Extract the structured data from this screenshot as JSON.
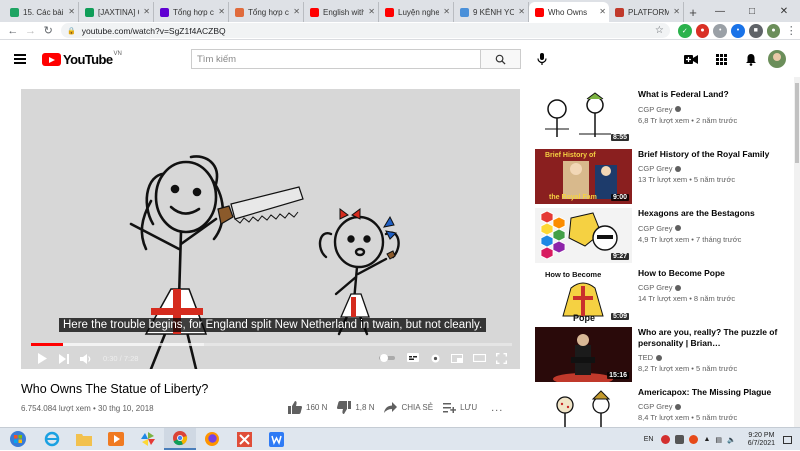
{
  "browser": {
    "tabs": [
      {
        "title": "15. Các bài S",
        "icon": "google-drive-icon",
        "color": "#1fa463"
      },
      {
        "title": "[JAXTINA] C",
        "icon": "google-sheets-icon",
        "color": "#0f9d58"
      },
      {
        "title": "Tổng hợp c",
        "icon": "yahoo-icon",
        "color": "#6001d2"
      },
      {
        "title": "Tổng hợp cá",
        "icon": "pinwheel-icon",
        "color": "#e06b3c"
      },
      {
        "title": "English with",
        "icon": "youtube-icon",
        "color": "#ff0000"
      },
      {
        "title": "Luyện nghe",
        "icon": "youtube-icon",
        "color": "#ff0000"
      },
      {
        "title": "9 KÊNH YO",
        "icon": "globe-icon",
        "color": "#4a90d9"
      },
      {
        "title": "Who Owns",
        "icon": "youtube-icon",
        "color": "#ff0000"
      },
      {
        "title": "PLATFORM",
        "icon": "platform-icon",
        "color": "#c0392b"
      }
    ],
    "url": "youtube.com/watch?v=SgZ1f4ACZBQ"
  },
  "yt": {
    "logo_text": "YouTube",
    "country_code": "VN",
    "search_placeholder": "Tìm kiếm"
  },
  "player": {
    "subtitle": "Here the trouble begins, for England split New Netherland in twain, but not cleanly.",
    "time": "0:30 / 7:28",
    "progress_fraction": 0.067,
    "loaded_fraction": 0.36
  },
  "video": {
    "title": "Who Owns The Statue of Liberty?",
    "meta": "6.754.084 lượt xem • 30 thg 10, 2018",
    "likes": "160 N",
    "dislikes": "1,8 N",
    "share": "CHIA SẺ",
    "save": "LƯU",
    "more": "..."
  },
  "sidebar": {
    "items": [
      {
        "title": "What is Federal Land?",
        "channel": "CGP Grey",
        "stats": "6,8 Tr lượt xem • 2 năm trước",
        "duration": "8:55",
        "thumb_text": ""
      },
      {
        "title": "Brief History of the Royal Family",
        "channel": "CGP Grey",
        "stats": "13 Tr lượt xem • 5 năm trước",
        "duration": "9:00",
        "thumb_text": "Brief History of the Royal Family"
      },
      {
        "title": "Hexagons are the Bestagons",
        "channel": "CGP Grey",
        "stats": "4,9 Tr lượt xem • 7 tháng trước",
        "duration": "9:27",
        "thumb_text": ""
      },
      {
        "title": "How to Become Pope",
        "channel": "CGP Grey",
        "stats": "14 Tr lượt xem • 8 năm trước",
        "duration": "5:09",
        "thumb_text_top": "How to Become",
        "thumb_text_bottom": "Pope"
      },
      {
        "title": "Who are you, really? The puzzle of personality | Brian…",
        "channel": "TED",
        "stats": "8,2 Tr lượt xem • 5 năm trước",
        "duration": "15:16",
        "thumb_text": ""
      },
      {
        "title": "Americapox: The Missing Plague",
        "channel": "CGP Grey",
        "stats": "8,4 Tr lượt xem • 5 năm trước",
        "duration": "",
        "thumb_text": ""
      }
    ]
  },
  "taskbar": {
    "lang": "EN",
    "time": "9:20 PM",
    "date": "6/7/2021"
  }
}
